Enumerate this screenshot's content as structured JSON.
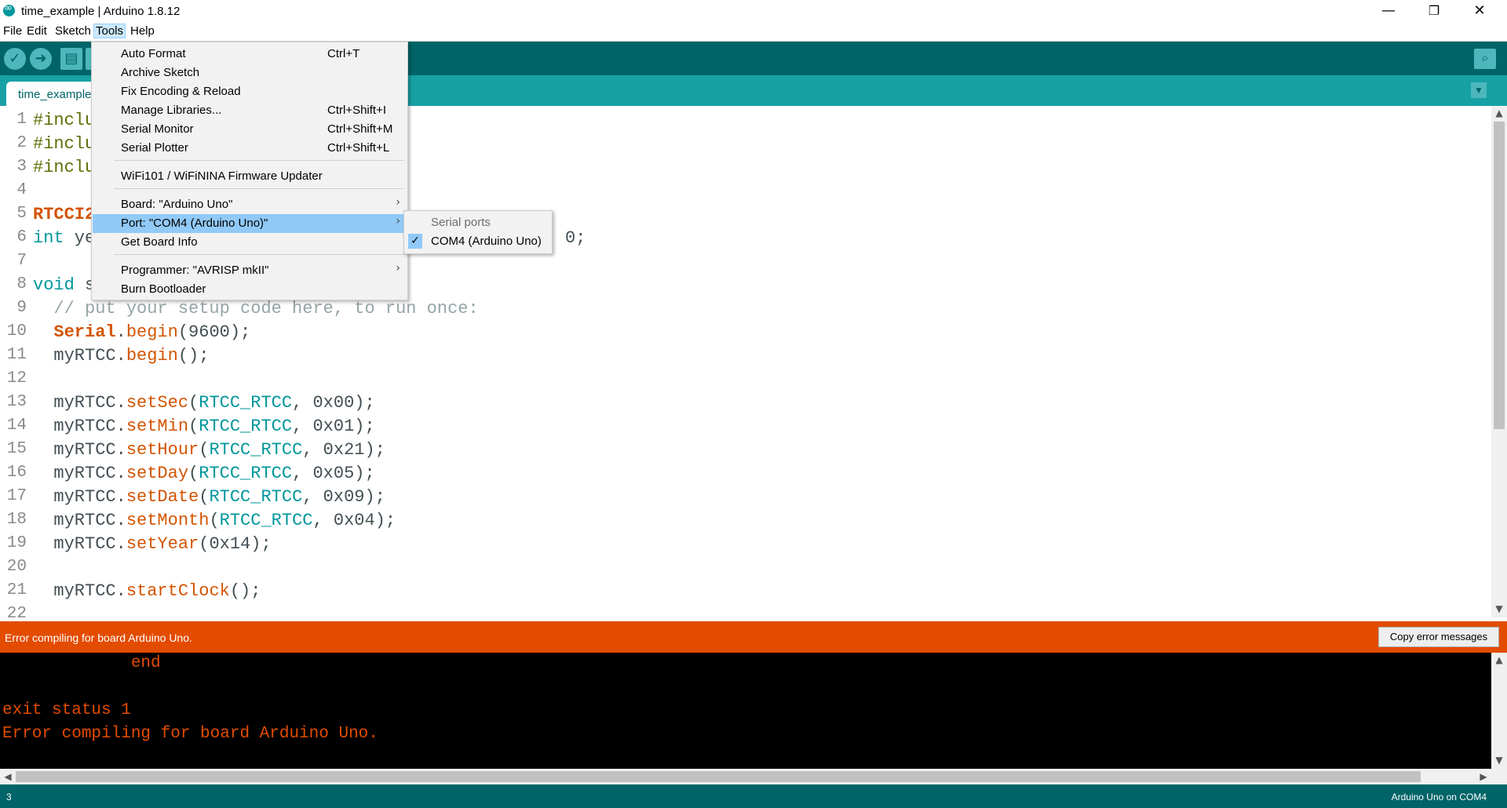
{
  "window": {
    "title": "time_example | Arduino 1.8.12",
    "minimize": "—",
    "maximize": "❐",
    "close": "✕"
  },
  "menubar": [
    "File",
    "Edit",
    "Sketch",
    "Tools",
    "Help"
  ],
  "toolbar": {
    "verify_icon": "✓",
    "upload_icon": "➜",
    "new_icon": "▤",
    "serial_icon": "⌕"
  },
  "tab": {
    "label": "time_example",
    "menu_icon": "▼"
  },
  "editor": {
    "lines": [
      {
        "n": "1",
        "text": "#inclu"
      },
      {
        "n": "2",
        "text": "#inclu"
      },
      {
        "n": "3",
        "text": "#inclu"
      },
      {
        "n": "4",
        "text": ""
      },
      {
        "n": "5",
        "text": "RTCCI2"
      },
      {
        "n": "6",
        "pre": "int",
        "text": " ye",
        "tail": "0;"
      },
      {
        "n": "7",
        "text": ""
      },
      {
        "n": "8",
        "pre": "void",
        "text": " s"
      },
      {
        "n": "9",
        "text": "  // put your setup code here, to run once:"
      },
      {
        "n": "10",
        "text": "  Serial.begin(9600);"
      },
      {
        "n": "11",
        "text": "  myRTCC.begin();"
      },
      {
        "n": "12",
        "text": ""
      },
      {
        "n": "13",
        "text": "  myRTCC.setSec(RTCC_RTCC, 0x00);"
      },
      {
        "n": "14",
        "text": "  myRTCC.setMin(RTCC_RTCC, 0x01);"
      },
      {
        "n": "15",
        "text": "  myRTCC.setHour(RTCC_RTCC, 0x21);"
      },
      {
        "n": "16",
        "text": "  myRTCC.setDay(RTCC_RTCC, 0x05);"
      },
      {
        "n": "17",
        "text": "  myRTCC.setDate(RTCC_RTCC, 0x09);"
      },
      {
        "n": "18",
        "text": "  myRTCC.setMonth(RTCC_RTCC, 0x04);"
      },
      {
        "n": "19",
        "text": "  myRTCC.setYear(0x14);"
      },
      {
        "n": "20",
        "text": ""
      },
      {
        "n": "21",
        "text": "  myRTCC.startClock();"
      },
      {
        "n": "22",
        "text": ""
      }
    ]
  },
  "tools_menu": {
    "items": [
      {
        "label": "Auto Format",
        "shortcut": "Ctrl+T"
      },
      {
        "label": "Archive Sketch",
        "shortcut": ""
      },
      {
        "label": "Fix Encoding & Reload",
        "shortcut": ""
      },
      {
        "label": "Manage Libraries...",
        "shortcut": "Ctrl+Shift+I"
      },
      {
        "label": "Serial Monitor",
        "shortcut": "Ctrl+Shift+M"
      },
      {
        "label": "Serial Plotter",
        "shortcut": "Ctrl+Shift+L"
      },
      {
        "label": "WiFi101 / WiFiNINA Firmware Updater",
        "shortcut": ""
      },
      {
        "label": "Board: \"Arduino Uno\"",
        "shortcut": ""
      },
      {
        "label": "Port: \"COM4 (Arduino Uno)\"",
        "shortcut": ""
      },
      {
        "label": "Get Board Info",
        "shortcut": ""
      },
      {
        "label": "Programmer: \"AVRISP mkII\"",
        "shortcut": ""
      },
      {
        "label": "Burn Bootloader",
        "shortcut": ""
      }
    ],
    "submenu_arrow": "›"
  },
  "port_submenu": {
    "header": "Serial ports",
    "item": "COM4 (Arduino Uno)",
    "check": "✓"
  },
  "error_bar": {
    "message": "Error compiling for board Arduino Uno.",
    "copy_button": "Copy error messages"
  },
  "console": {
    "lines": [
      "             end",
      "",
      "exit status 1",
      "Error compiling for board Arduino Uno."
    ]
  },
  "status": {
    "line": "3",
    "board": "Arduino Uno on COM4"
  },
  "colors": {
    "teal_dark": "#006468",
    "teal": "#17a1a5",
    "error": "#e34c00",
    "highlight": "#91c9f7"
  }
}
